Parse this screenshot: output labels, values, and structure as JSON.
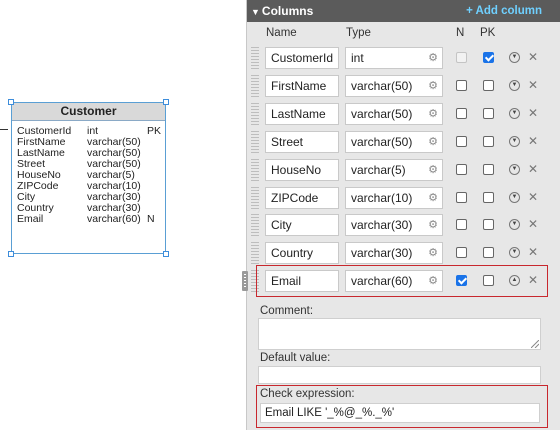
{
  "entity": {
    "title": "Customer",
    "columns": [
      {
        "name": "CustomerId",
        "type": "int",
        "flag": "PK"
      },
      {
        "name": "FirstName",
        "type": "varchar(50)",
        "flag": ""
      },
      {
        "name": "LastName",
        "type": "varchar(50)",
        "flag": ""
      },
      {
        "name": "Street",
        "type": "varchar(50)",
        "flag": ""
      },
      {
        "name": "HouseNo",
        "type": "varchar(5)",
        "flag": ""
      },
      {
        "name": "ZIPCode",
        "type": "varchar(10)",
        "flag": ""
      },
      {
        "name": "City",
        "type": "varchar(30)",
        "flag": ""
      },
      {
        "name": "Country",
        "type": "varchar(30)",
        "flag": ""
      },
      {
        "name": "Email",
        "type": "varchar(60)",
        "flag": "N"
      }
    ]
  },
  "panel": {
    "title": "Columns",
    "add_label": "+ Add column",
    "headers": {
      "name": "Name",
      "type": "Type",
      "n": "N",
      "pk": "PK"
    },
    "rows": [
      {
        "name": "CustomerId",
        "type": "int",
        "n": false,
        "pk": true,
        "n_disabled": true
      },
      {
        "name": "FirstName",
        "type": "varchar(50)",
        "n": false,
        "pk": false
      },
      {
        "name": "LastName",
        "type": "varchar(50)",
        "n": false,
        "pk": false
      },
      {
        "name": "Street",
        "type": "varchar(50)",
        "n": false,
        "pk": false
      },
      {
        "name": "HouseNo",
        "type": "varchar(5)",
        "n": false,
        "pk": false
      },
      {
        "name": "ZIPCode",
        "type": "varchar(10)",
        "n": false,
        "pk": false
      },
      {
        "name": "City",
        "type": "varchar(30)",
        "n": false,
        "pk": false
      },
      {
        "name": "Country",
        "type": "varchar(30)",
        "n": false,
        "pk": false
      },
      {
        "name": "Email",
        "type": "varchar(60)",
        "n": true,
        "pk": false,
        "selected": true
      }
    ],
    "comment_label": "Comment:",
    "comment_value": "",
    "default_label": "Default value:",
    "default_value": "",
    "check_label": "Check expression:",
    "check_value": "Email LIKE '_%@_%._%'"
  },
  "colors": {
    "header_bg": "#5b5b5b",
    "accent": "#6fd0ff",
    "highlight": "#c8282e",
    "checkbox": "#1a73e8"
  }
}
